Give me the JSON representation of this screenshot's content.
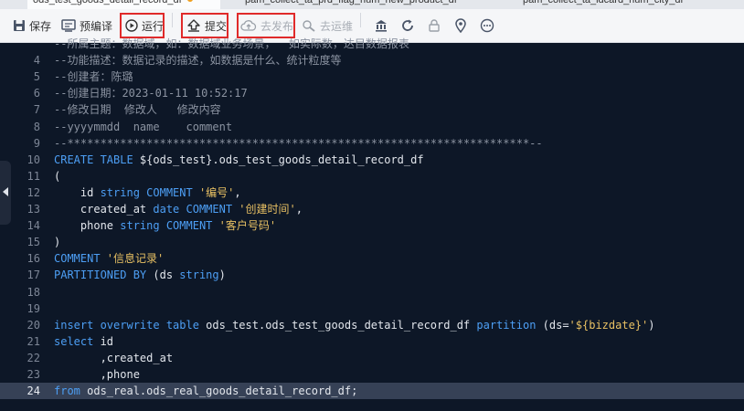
{
  "tabs": [
    {
      "label": "ods_test_goods_detail_record_df",
      "modified": true
    },
    {
      "label": "pam_collect_ta_prd_flag_num_new_product_df"
    },
    {
      "label": "pam_collect_ta_idcard_num_city_df"
    }
  ],
  "toolbar": {
    "save": "保存",
    "precompile": "预编译",
    "run": "运行",
    "submit": "提交",
    "publish": "去发布",
    "ops": "去运维",
    "icons": [
      "library-icon",
      "refresh-icon",
      "lock-icon",
      "location-icon",
      "more-icon"
    ]
  },
  "editor": {
    "current_line": 24,
    "lines": [
      {
        "n": "",
        "tokens": [
          {
            "t": "c",
            "s": "--所属主题：数据域，如：数据域业务场景，  如实际数，达目数据报表"
          }
        ]
      },
      {
        "n": "4",
        "tokens": [
          {
            "t": "c",
            "s": "--功能描述：数据记录的描述，如数据是什么、统计粒度等"
          }
        ]
      },
      {
        "n": "5",
        "tokens": [
          {
            "t": "c",
            "s": "--创建者：陈璐"
          }
        ]
      },
      {
        "n": "6",
        "tokens": [
          {
            "t": "c",
            "s": "--创建日期：2023-01-11 10:52:17"
          }
        ]
      },
      {
        "n": "7",
        "tokens": [
          {
            "t": "c",
            "s": "--修改日期  修改人   修改内容"
          }
        ]
      },
      {
        "n": "8",
        "tokens": [
          {
            "t": "c",
            "s": "--yyyymmdd  name    comment"
          }
        ]
      },
      {
        "n": "9",
        "tokens": [
          {
            "t": "c",
            "s": "--**********************************************************************--"
          }
        ]
      },
      {
        "n": "10",
        "tokens": [
          {
            "t": "k",
            "s": "CREATE TABLE "
          },
          {
            "t": "p",
            "s": "${ods_test}.ods_test_goods_detail_record_df"
          }
        ]
      },
      {
        "n": "11",
        "tokens": [
          {
            "t": "p",
            "s": "("
          }
        ]
      },
      {
        "n": "12",
        "tokens": [
          {
            "t": "p",
            "s": "    id "
          },
          {
            "t": "k",
            "s": "string COMMENT "
          },
          {
            "t": "s",
            "s": "'编号'"
          },
          {
            "t": "p",
            "s": ","
          }
        ]
      },
      {
        "n": "13",
        "tokens": [
          {
            "t": "p",
            "s": "    created_at "
          },
          {
            "t": "k",
            "s": "date COMMENT "
          },
          {
            "t": "s",
            "s": "'创建时间'"
          },
          {
            "t": "p",
            "s": ","
          }
        ]
      },
      {
        "n": "14",
        "tokens": [
          {
            "t": "p",
            "s": "    phone "
          },
          {
            "t": "k",
            "s": "string COMMENT "
          },
          {
            "t": "s",
            "s": "'客户号码'"
          }
        ]
      },
      {
        "n": "15",
        "tokens": [
          {
            "t": "p",
            "s": ")"
          }
        ]
      },
      {
        "n": "16",
        "tokens": [
          {
            "t": "k",
            "s": "COMMENT "
          },
          {
            "t": "s",
            "s": "'信息记录'"
          }
        ]
      },
      {
        "n": "17",
        "tokens": [
          {
            "t": "k",
            "s": "PARTITIONED BY "
          },
          {
            "t": "p",
            "s": "(ds "
          },
          {
            "t": "k",
            "s": "string"
          },
          {
            "t": "p",
            "s": ")"
          }
        ]
      },
      {
        "n": "18",
        "tokens": []
      },
      {
        "n": "19",
        "tokens": []
      },
      {
        "n": "20",
        "tokens": [
          {
            "t": "k",
            "s": "insert overwrite table "
          },
          {
            "t": "p",
            "s": "ods_test.ods_test_goods_detail_record_df "
          },
          {
            "t": "k",
            "s": "partition "
          },
          {
            "t": "p",
            "s": "(ds="
          },
          {
            "t": "s",
            "s": "'${bizdate}'"
          },
          {
            "t": "p",
            "s": ")"
          }
        ]
      },
      {
        "n": "21",
        "tokens": [
          {
            "t": "k",
            "s": "select "
          },
          {
            "t": "p",
            "s": "id"
          }
        ]
      },
      {
        "n": "22",
        "tokens": [
          {
            "t": "p",
            "s": "       ,created_at"
          }
        ]
      },
      {
        "n": "23",
        "tokens": [
          {
            "t": "p",
            "s": "       ,phone"
          }
        ]
      },
      {
        "n": "24",
        "tokens": [
          {
            "t": "k",
            "s": "from "
          },
          {
            "t": "p",
            "s": "ods_real.ods_real_goods_detail_record_df;"
          }
        ]
      }
    ]
  }
}
